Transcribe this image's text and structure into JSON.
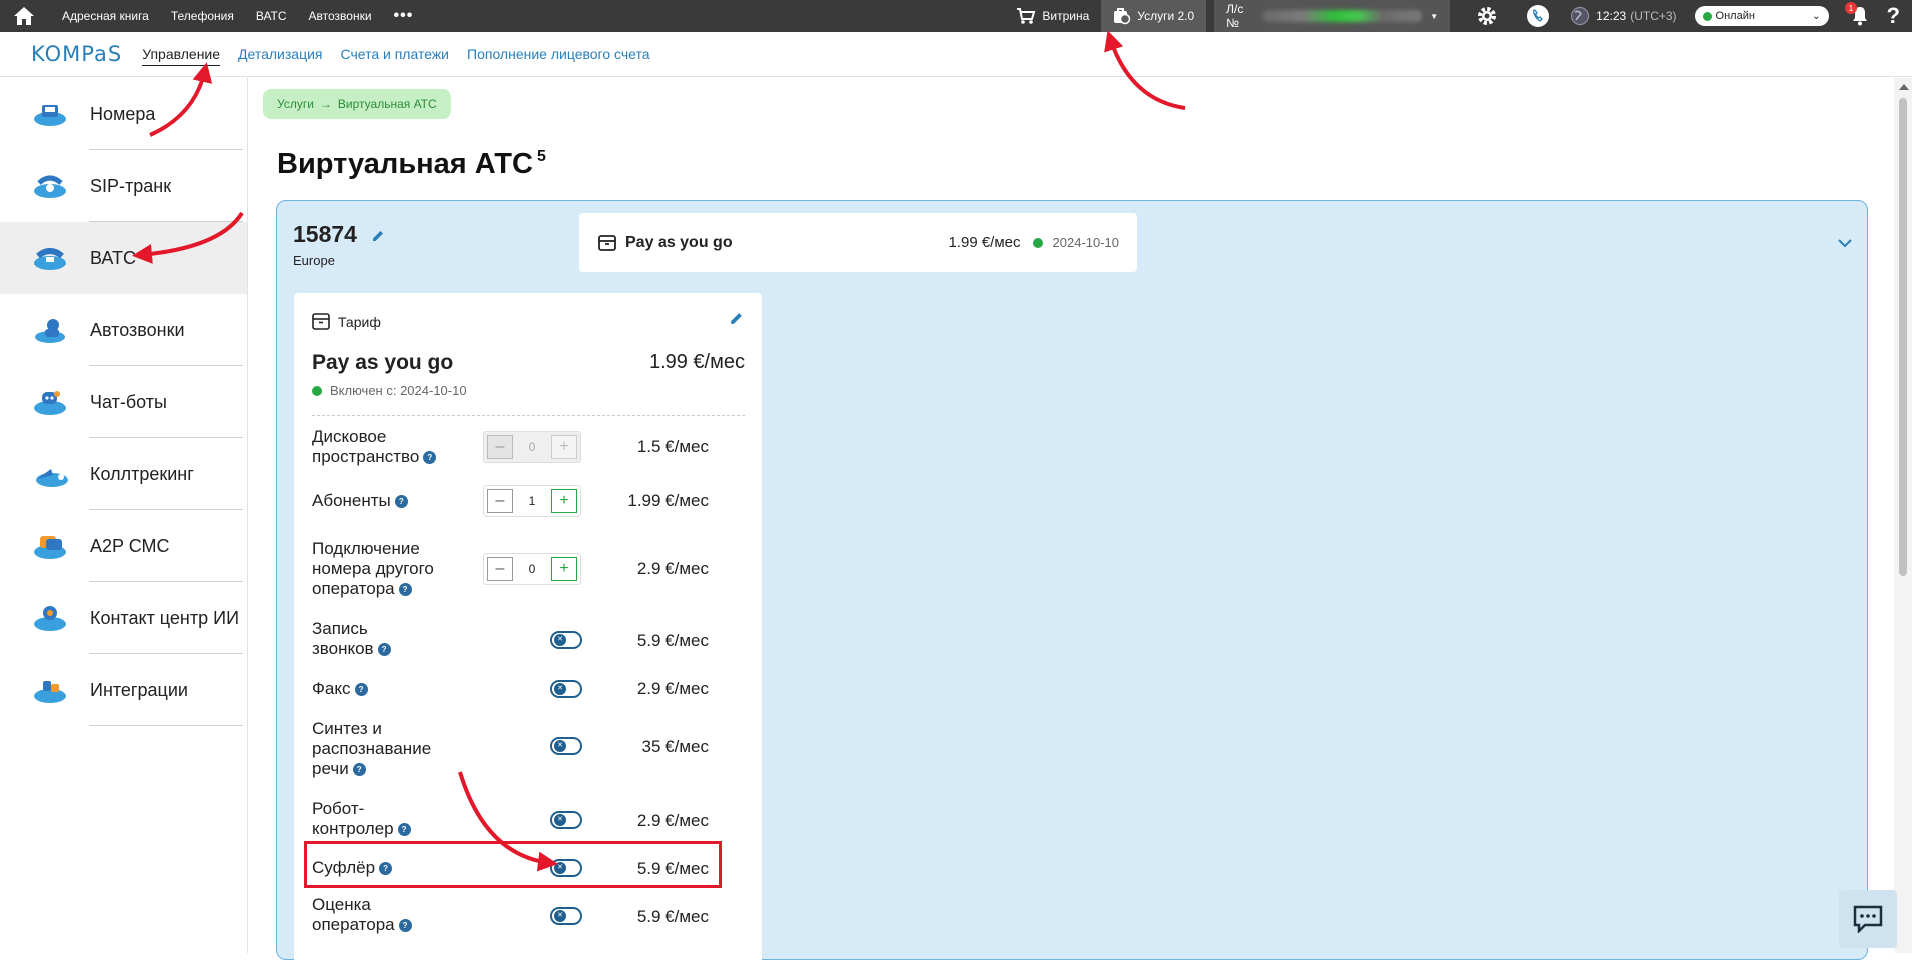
{
  "topbar": {
    "nav": [
      "Адресная книга",
      "Телефония",
      "ВАТС",
      "Автозвонки"
    ],
    "more": "•••",
    "showcase_label": "Витрина",
    "services_label": "Услуги 2.0",
    "account_label": "Л/с №",
    "time": "12:23",
    "timezone": "(UTC+3)",
    "status": "Онлайн",
    "notifications_count": "1"
  },
  "subbar": {
    "logo": "KOMPaS",
    "tabs": [
      "Управление",
      "Детализация",
      "Счета и платежи",
      "Пополнение лицевого счета"
    ]
  },
  "sidebar": {
    "items": [
      {
        "label": "Номера"
      },
      {
        "label": "SIP-транк"
      },
      {
        "label": "ВАТС"
      },
      {
        "label": "Автозвонки"
      },
      {
        "label": "Чат-боты"
      },
      {
        "label": "Коллтрекинг"
      },
      {
        "label": "A2P СМС"
      },
      {
        "label": "Контакт центр ИИ"
      },
      {
        "label": "Интеграции"
      }
    ]
  },
  "breadcrumb": {
    "root": "Услуги",
    "arrow": "→",
    "current": "Виртуальная АТС"
  },
  "page": {
    "title": "Виртуальная АТС",
    "count": "5"
  },
  "pbx": {
    "number": "15874",
    "region": "Europe",
    "tariff_name": "Pay as you go",
    "tariff_price": "1.99 €/мес",
    "tariff_date": "2024-10-10"
  },
  "card": {
    "header": "Тариф",
    "plan_name": "Pay as you go",
    "plan_price": "1.99 €/мес",
    "since": "Включен с: 2024-10-10",
    "options": [
      {
        "name": "Дисковое пространство",
        "control": "stepper",
        "value": "0",
        "disabled": true,
        "price": "1.5 €/мес"
      },
      {
        "name": "Абоненты",
        "control": "stepper",
        "value": "1",
        "price": "1.99 €/мес"
      },
      {
        "name": "Подключение номера другого оператора",
        "control": "stepper",
        "value": "0",
        "price": "2.9 €/мес"
      },
      {
        "name": "Запись звонков",
        "control": "toggle",
        "price": "5.9 €/мес"
      },
      {
        "name": "Факс",
        "control": "toggle",
        "price": "2.9 €/мес"
      },
      {
        "name": "Синтез и распознавание речи",
        "control": "toggle",
        "price": "35 €/мес"
      },
      {
        "name": "Робот-контролер",
        "control": "toggle",
        "price": "2.9 €/мес"
      },
      {
        "name": "Суфлёр",
        "control": "toggle",
        "price": "5.9 €/мес"
      },
      {
        "name": "Оценка оператора",
        "control": "toggle",
        "price": "5.9 €/мес"
      }
    ],
    "minus": "–",
    "plus": "+",
    "help": "?"
  },
  "colors": {
    "accent": "#2a7fb8",
    "panel": "#d7eaf7",
    "green": "#27a844",
    "highlight": "#e3192b"
  }
}
